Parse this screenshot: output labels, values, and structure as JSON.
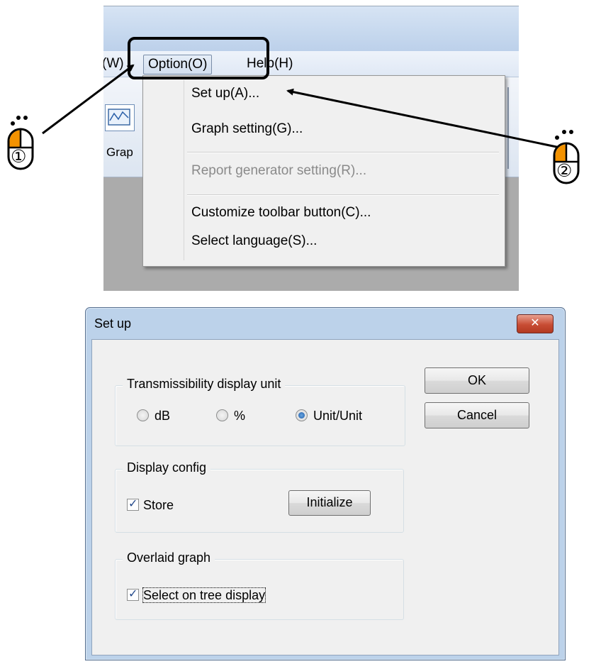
{
  "menubar": {
    "window_label": "(W)",
    "option_label": "Option(O)",
    "help_label": "Help(H)"
  },
  "toolbar": {
    "graph_label": "Grap"
  },
  "option_menu": {
    "items": [
      {
        "label": "Set up(A)...",
        "enabled": true
      },
      {
        "label": "Graph setting(G)...",
        "enabled": true
      },
      {
        "label": "Report generator setting(R)...",
        "enabled": false
      },
      {
        "label": "Customize toolbar button(C)...",
        "enabled": true
      },
      {
        "label": "Select language(S)...",
        "enabled": true
      }
    ]
  },
  "steps": {
    "step1": "①",
    "step2": "②"
  },
  "dialog": {
    "title": "Set up",
    "close_glyph": "✕",
    "ok_label": "OK",
    "cancel_label": "Cancel",
    "transmissibility": {
      "title": "Transmissibility display unit",
      "options": [
        "dB",
        "%",
        "Unit/Unit"
      ],
      "selected": "Unit/Unit"
    },
    "display_config": {
      "title": "Display config",
      "store_label": "Store",
      "store_checked": true,
      "initialize_label": "Initialize"
    },
    "overlaid_graph": {
      "title": "Overlaid graph",
      "select_label": "Select on tree display",
      "select_checked": true
    }
  },
  "colors": {
    "mouse_accent": "#f39200",
    "highlight_border": "#000000"
  }
}
